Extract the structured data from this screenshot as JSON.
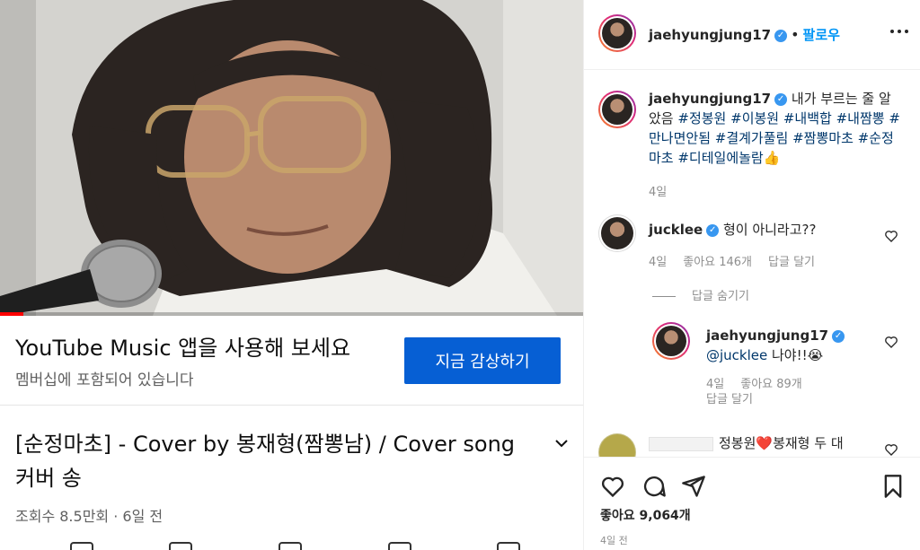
{
  "video": {
    "progress": 0.04,
    "progress_color": "#ff0000"
  },
  "ytm_banner": {
    "title": "YouTube Music 앱을 사용해 보세요",
    "subtitle": "멤버십에 포함되어 있습니다",
    "button_label": "지금 감상하기",
    "button_color": "#065fd4"
  },
  "yt_video": {
    "title": "[순정마초]  - Cover  by 봉재형(짬뽕남) / Cover song 커버 송",
    "meta": "조회수 8.5만회 · 6일 전"
  },
  "post": {
    "author": "jaehyungjung17",
    "follow_label": "팔로우",
    "dot": "•",
    "caption_author": "jaehyungjung17",
    "caption_text": "내가 부르는 줄 알았음",
    "caption_tags": "#정봉원 #이봉원 #내백합 #내짬뽕 #만나면안됨 #결계가풀림 #짬뽕마초 #순정마초 #디테일에놀람👍",
    "caption_age": "4일",
    "likes": "좋아요 9,064개",
    "age": "4일 전"
  },
  "comments": [
    {
      "user": "jucklee",
      "text": "형이 아니라고??",
      "age": "4일",
      "likes": "좋아요 146개",
      "reply_label": "답글 달기"
    },
    {
      "user": "jaehyungjung17",
      "mention": "@jucklee",
      "text": " 나야!!😭",
      "age": "4일",
      "likes": "좋아요 89개",
      "reply_label": "답글 달기"
    },
    {
      "user_hidden": true,
      "text": "정봉원❤️봉재형 두 대"
    }
  ],
  "hide_replies_label": "답글 숨기기",
  "icons": {
    "verified": "verified-badge-icon",
    "more": "more-options-icon",
    "heart": "heart-icon",
    "comment": "comment-icon",
    "share": "share-icon",
    "save": "bookmark-icon"
  },
  "colors": {
    "instagram_link": "#0095f6",
    "hashtag": "#00376b",
    "muted": "#8e8e8e"
  }
}
